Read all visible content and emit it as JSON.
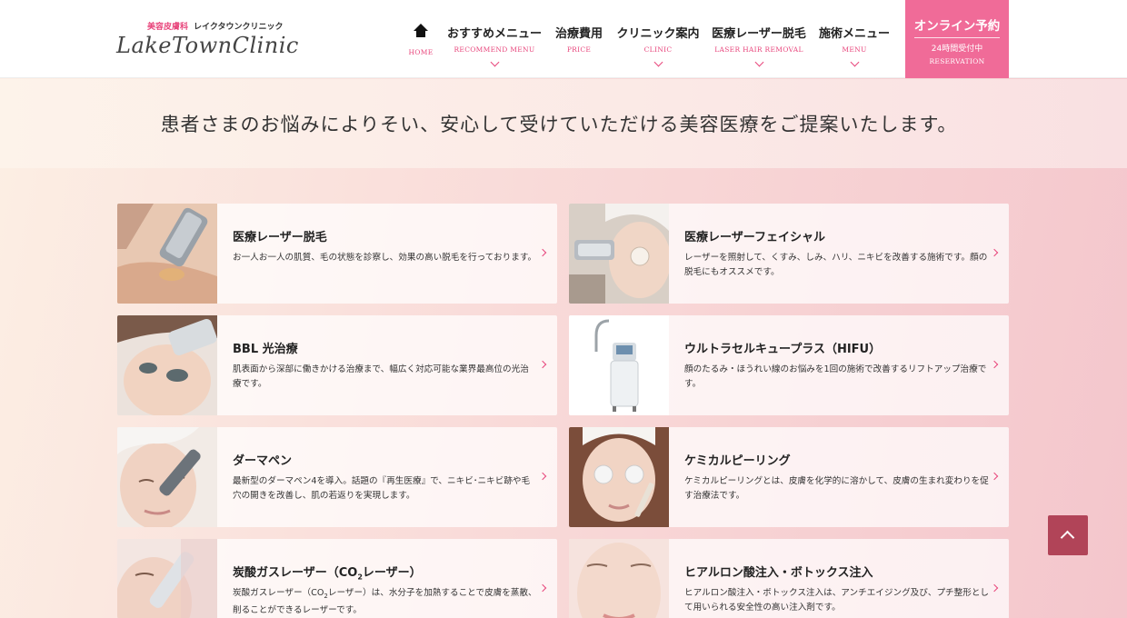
{
  "header": {
    "logo_sub_pink": "美容皮膚科",
    "logo_sub": "レイクタウンクリニック",
    "logo_main": "LakeTownClinic",
    "nav": [
      {
        "jp": "",
        "en": "HOME",
        "icon": "home-icon"
      },
      {
        "jp": "おすすめメニュー",
        "en": "RECOMMEND MENU",
        "icon": "chevron-down-icon"
      },
      {
        "jp": "治療費用",
        "en": "PRICE"
      },
      {
        "jp": "クリニック案内",
        "en": "CLINIC",
        "icon": "chevron-down-icon"
      },
      {
        "jp": "医療レーザー脱毛",
        "en": "LASER HAIR REMOVAL",
        "icon": "chevron-down-icon"
      },
      {
        "jp": "施術メニュー",
        "en": "MENU",
        "icon": "chevron-down-icon"
      }
    ],
    "reserve": {
      "label": "オンライン予約",
      "hours": "24時間受付中",
      "en": "RESERVATION"
    }
  },
  "tagline": "患者さまのお悩みによりそい、安心して受けていただける美容医療をご提案いたします。",
  "cards": [
    {
      "title": "医療レーザー脱毛",
      "desc": "お一人お一人の肌質、毛の状態を診察し、効果の高い脱毛を行っております。"
    },
    {
      "title": "医療レーザーフェイシャル",
      "desc": "レーザーを照射して、くすみ、しみ、ハリ、ニキビを改善する施術です。顔の脱毛にもオススメです。"
    },
    {
      "title": "BBL 光治療",
      "desc": "肌表面から深部に働きかける治療まで、幅広く対応可能な業界最高位の光治療です。"
    },
    {
      "title": "ウルトラセルキュープラス（HIFU）",
      "desc": "顔のたるみ・ほうれい線のお悩みを1回の施術で改善するリフトアップ治療です。"
    },
    {
      "title": "ダーマペン",
      "desc": "最新型のダーマペン4を導入。話題の『再生医療』で、ニキビ･ニキビ跡や毛穴の開きを改善し、肌の若返りを実現します。"
    },
    {
      "title": "ケミカルピーリング",
      "desc": "ケミカルピーリングとは、皮膚を化学的に溶かして、皮膚の生まれ変わりを促す治療法です。"
    },
    {
      "title_pre": "炭酸ガスレーザー（CO",
      "title_sub": "2",
      "title_post": "レーザー）",
      "desc_pre": "炭酸ガスレーザー（CO",
      "desc_sub": "2",
      "desc_post": "レーザー）は、水分子を加熱することで皮膚を蒸散、削ることができるレーザーです。"
    },
    {
      "title": "ヒアルロン酸注入・ボトックス注入",
      "desc": "ヒアルロン酸注入・ボトックス注入は、アンチエイジング及び、プチ整形として用いられる安全性の高い注入剤です。"
    }
  ],
  "colors": {
    "accent": "#e8467c",
    "reserve_bg": "#f06b98",
    "to_top_bg": "#b14458"
  }
}
